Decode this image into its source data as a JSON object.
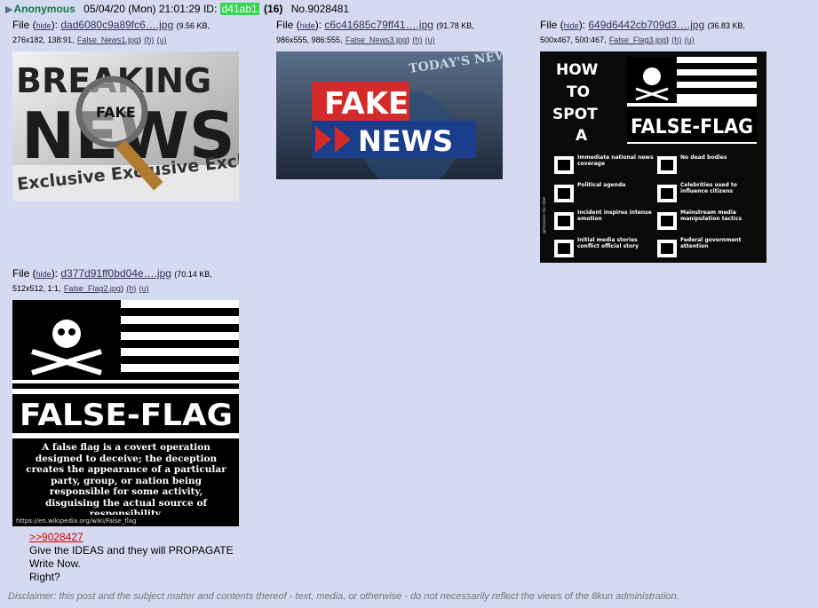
{
  "header": {
    "arrow": "▶",
    "name": "Anonymous",
    "date": "05/04/20 (Mon) 21:01:29",
    "id_label": "ID:",
    "id_value": "d41ab1",
    "post_count": "(16)",
    "post_no": "No.9028481"
  },
  "files": [
    {
      "prefix": "File (",
      "hide": "hide",
      "mid": "):",
      "name": "dad6080c9a89fc6….jpg",
      "meta1": "(9.56 KB,",
      "meta2": "276x182, 138:91,",
      "orig": "False_News1.jpg",
      "h": "(h)",
      "u": "(u)",
      "image": {
        "caption_top": "BREAKING",
        "caption_mid": "NEWS",
        "lens_text": "FAKE",
        "caption_bottom": "Exclusive Exclusive Excl"
      }
    },
    {
      "prefix": "File (",
      "hide": "hide",
      "mid": "):",
      "name": "c6c41685c79ff41….jpg",
      "meta1": "(91.78 KB,",
      "meta2": "986x555, 986:555,",
      "orig": "False_News3.jpg",
      "h": "(h)",
      "u": "(u)",
      "image": {
        "top_word": "FAKE",
        "bottom_word": "NEWS",
        "bg_text": "TODAY'S NEWS"
      }
    },
    {
      "prefix": "File (",
      "hide": "hide",
      "mid": "):",
      "name": "649d6442cb709d3….jpg",
      "meta1": "(36.83 KB,",
      "meta2": "500x467, 500:467,",
      "orig": "False_Flag3.jpg",
      "h": "(h)",
      "u": "(u)",
      "image": {
        "how_lines": [
          "HOW",
          "TO",
          "SPOT",
          "A"
        ],
        "flag_title": "FALSE-FLAG",
        "side_text": "@theodore the rebel",
        "items_left": [
          "Immediate national news coverage",
          "Political agenda",
          "Incident inspires intense emotion",
          "Initial media stories conflict official story"
        ],
        "items_right": [
          "No dead bodies",
          "Celebrities used to influence citizens",
          "Mainstream media manipulation tactics",
          "Federal government attention"
        ]
      }
    },
    {
      "prefix": "File (",
      "hide": "hide",
      "mid": "):",
      "name": "d377d91ff0bd04e….jpg",
      "meta1": "(70.14 KB,",
      "meta2": "512x512, 1:1,",
      "orig": "False_Flag2.jpg",
      "h": "(h)",
      "u": "(u)",
      "image": {
        "flag_title": "FALSE-FLAG",
        "definition": "A false flag is a covert operation designed to deceive; the deception creates the appearance of a particular party, group, or nation being responsible for some activity, disguising the actual source of responsibility.",
        "url": "https://en.wikipedia.org/wiki/False_flag"
      }
    }
  ],
  "body": {
    "quote": ">>9028427",
    "lines": [
      "Give the IDEAS and they will PROPAGATE",
      "Write Now.",
      "Right?"
    ]
  },
  "disclaimer": "Disclaimer: this post and the subject matter and contents thereof - text, media, or otherwise - do not necessarily reflect the views of the 8kun administration.",
  "colors": {
    "post_bg": "#d6daf0",
    "name": "#117743",
    "id_bg": "#32d94e",
    "link": "#34345c",
    "quote": "#dd0000"
  }
}
